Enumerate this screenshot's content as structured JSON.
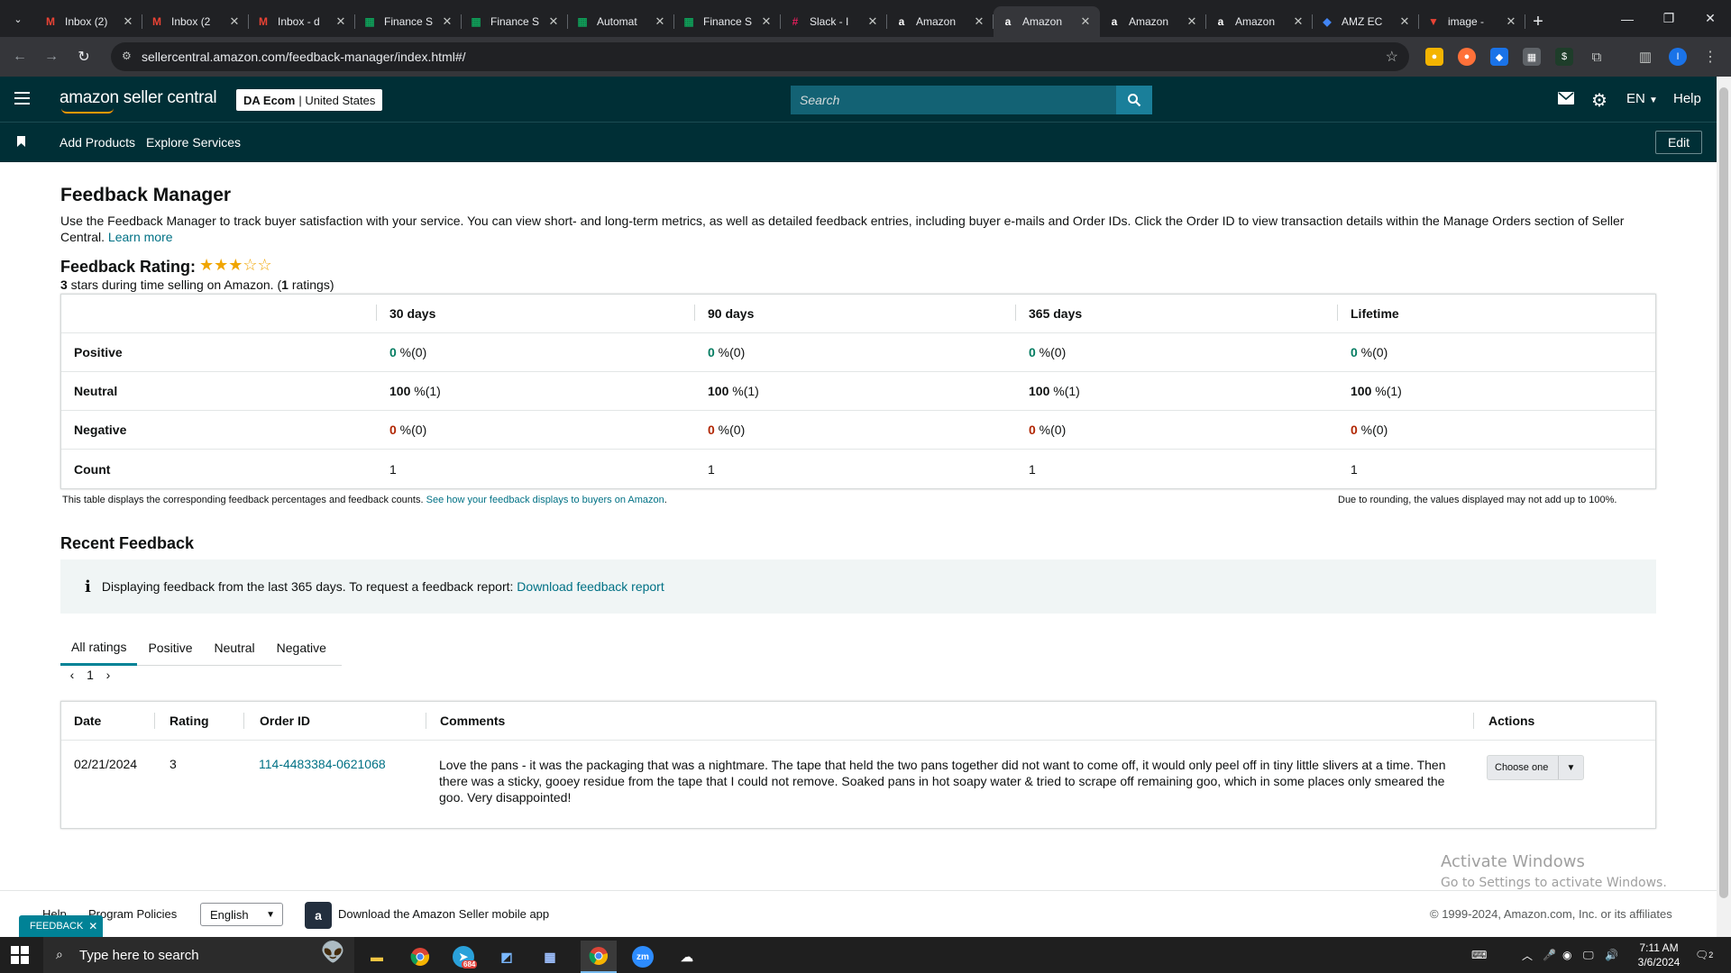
{
  "browser": {
    "tabs": [
      {
        "title": "Inbox (2)",
        "icon": "gmail-icon",
        "color": "#ea4335"
      },
      {
        "title": "Inbox (2",
        "icon": "gmail-icon",
        "color": "#ea4335"
      },
      {
        "title": "Inbox - d",
        "icon": "gmail-icon",
        "color": "#ea4335"
      },
      {
        "title": "Finance S",
        "icon": "sheets-icon",
        "color": "#0f9d58"
      },
      {
        "title": "Finance S",
        "icon": "sheets-icon",
        "color": "#0f9d58"
      },
      {
        "title": "Automat",
        "icon": "sheets-icon",
        "color": "#0f9d58"
      },
      {
        "title": "Finance S",
        "icon": "sheets-icon",
        "color": "#0f9d58"
      },
      {
        "title": "Slack - I",
        "icon": "slack-icon",
        "color": "#e01e5a"
      },
      {
        "title": "Amazon",
        "icon": "amazon-icon",
        "color": "#ffffff"
      },
      {
        "title": "Amazon",
        "icon": "amazon-icon",
        "color": "#ffffff",
        "active": true
      },
      {
        "title": "Amazon",
        "icon": "amazon-icon",
        "color": "#ffffff"
      },
      {
        "title": "Amazon",
        "icon": "amazon-icon",
        "color": "#ffffff"
      },
      {
        "title": "AMZ EC",
        "icon": "amz-icon",
        "color": "#4285f4"
      },
      {
        "title": "image -",
        "icon": "image-icon",
        "color": "#ea4335"
      }
    ],
    "url": "sellercentral.amazon.com/feedback-manager/index.html#/",
    "profile_initial": "I"
  },
  "header": {
    "logo_text": "amazon seller central",
    "account_name": "DA Ecom",
    "account_region": "United States",
    "search_placeholder": "Search",
    "language": "EN",
    "help": "Help"
  },
  "subnav": {
    "items": [
      "Add Products",
      "Explore Services"
    ],
    "edit": "Edit"
  },
  "page": {
    "title": "Feedback Manager",
    "description": "Use the Feedback Manager to track buyer satisfaction with your service. You can view short- and long-term metrics, as well as detailed feedback entries, including buyer e-mails and Order IDs. Click the Order ID to view transaction details within the Manage Orders section of Seller Central.",
    "learn_more": "Learn more",
    "rating_label": "Feedback Rating:",
    "rating_value": 3,
    "rating_stars": "★★★☆☆",
    "rating_sub_stars": "3",
    "rating_sub_text": " stars during time selling on Amazon. (",
    "rating_sub_count": "1",
    "rating_sub_end": " ratings)"
  },
  "metrics": {
    "headers": [
      "30 days",
      "90 days",
      "365 days",
      "Lifetime"
    ],
    "rows": [
      {
        "label": "Positive",
        "values": [
          {
            "n": "0",
            "s": " %(0)"
          },
          {
            "n": "0",
            "s": " %(0)"
          },
          {
            "n": "0",
            "s": " %(0)"
          },
          {
            "n": "0",
            "s": " %(0)"
          }
        ]
      },
      {
        "label": "Neutral",
        "values": [
          {
            "n": "100",
            "s": " %(1)"
          },
          {
            "n": "100",
            "s": " %(1)"
          },
          {
            "n": "100",
            "s": " %(1)"
          },
          {
            "n": "100",
            "s": " %(1)"
          }
        ]
      },
      {
        "label": "Negative",
        "values": [
          {
            "n": "0",
            "s": " %(0)"
          },
          {
            "n": "0",
            "s": " %(0)"
          },
          {
            "n": "0",
            "s": " %(0)"
          },
          {
            "n": "0",
            "s": " %(0)"
          }
        ]
      },
      {
        "label": "Count",
        "values": [
          {
            "n": "",
            "s": "1"
          },
          {
            "n": "",
            "s": "1"
          },
          {
            "n": "",
            "s": "1"
          },
          {
            "n": "",
            "s": "1"
          }
        ]
      }
    ],
    "note_left": "This table displays the corresponding feedback percentages and feedback counts.",
    "note_link": "See how your feedback displays to buyers on Amazon",
    "note_right": "Due to rounding, the values displayed may not add up to 100%."
  },
  "recent": {
    "title": "Recent Feedback",
    "alert_text": "Displaying feedback from the last 365 days. To request a feedback report:",
    "alert_link": "Download feedback report",
    "tabs": [
      "All ratings",
      "Positive",
      "Neutral",
      "Negative"
    ],
    "page": "1",
    "columns": [
      "Date",
      "Rating",
      "Order ID",
      "Comments",
      "Actions"
    ],
    "rows": [
      {
        "date": "02/21/2024",
        "rating": "3",
        "order_id": "114-4483384-0621068",
        "comment": "Love the pans - it was the packaging that was a nightmare. The tape that held the two pans together did not want to come off, it would only peel off in tiny little slivers at a time. Then there was a sticky, gooey residue from the tape that I could not remove. Soaked pans in hot soapy water & tried to scrape off remaining goo, which in some places only smeared the goo. Very disappointed!",
        "action": "Choose one"
      }
    ]
  },
  "footer": {
    "help": "Help",
    "policies": "Program Policies",
    "language": "English",
    "app_text": "Download the Amazon Seller mobile app",
    "copyright": "© 1999-2024, Amazon.com, Inc. or its affiliates",
    "feedback": "FEEDBACK"
  },
  "watermark": {
    "line1": "Activate Windows",
    "line2": "Go to Settings to activate Windows."
  },
  "taskbar": {
    "search_placeholder": "Type here to search",
    "time": "7:11 AM",
    "date": "3/6/2024",
    "notification_count": "2",
    "telegram_badge": "684"
  }
}
